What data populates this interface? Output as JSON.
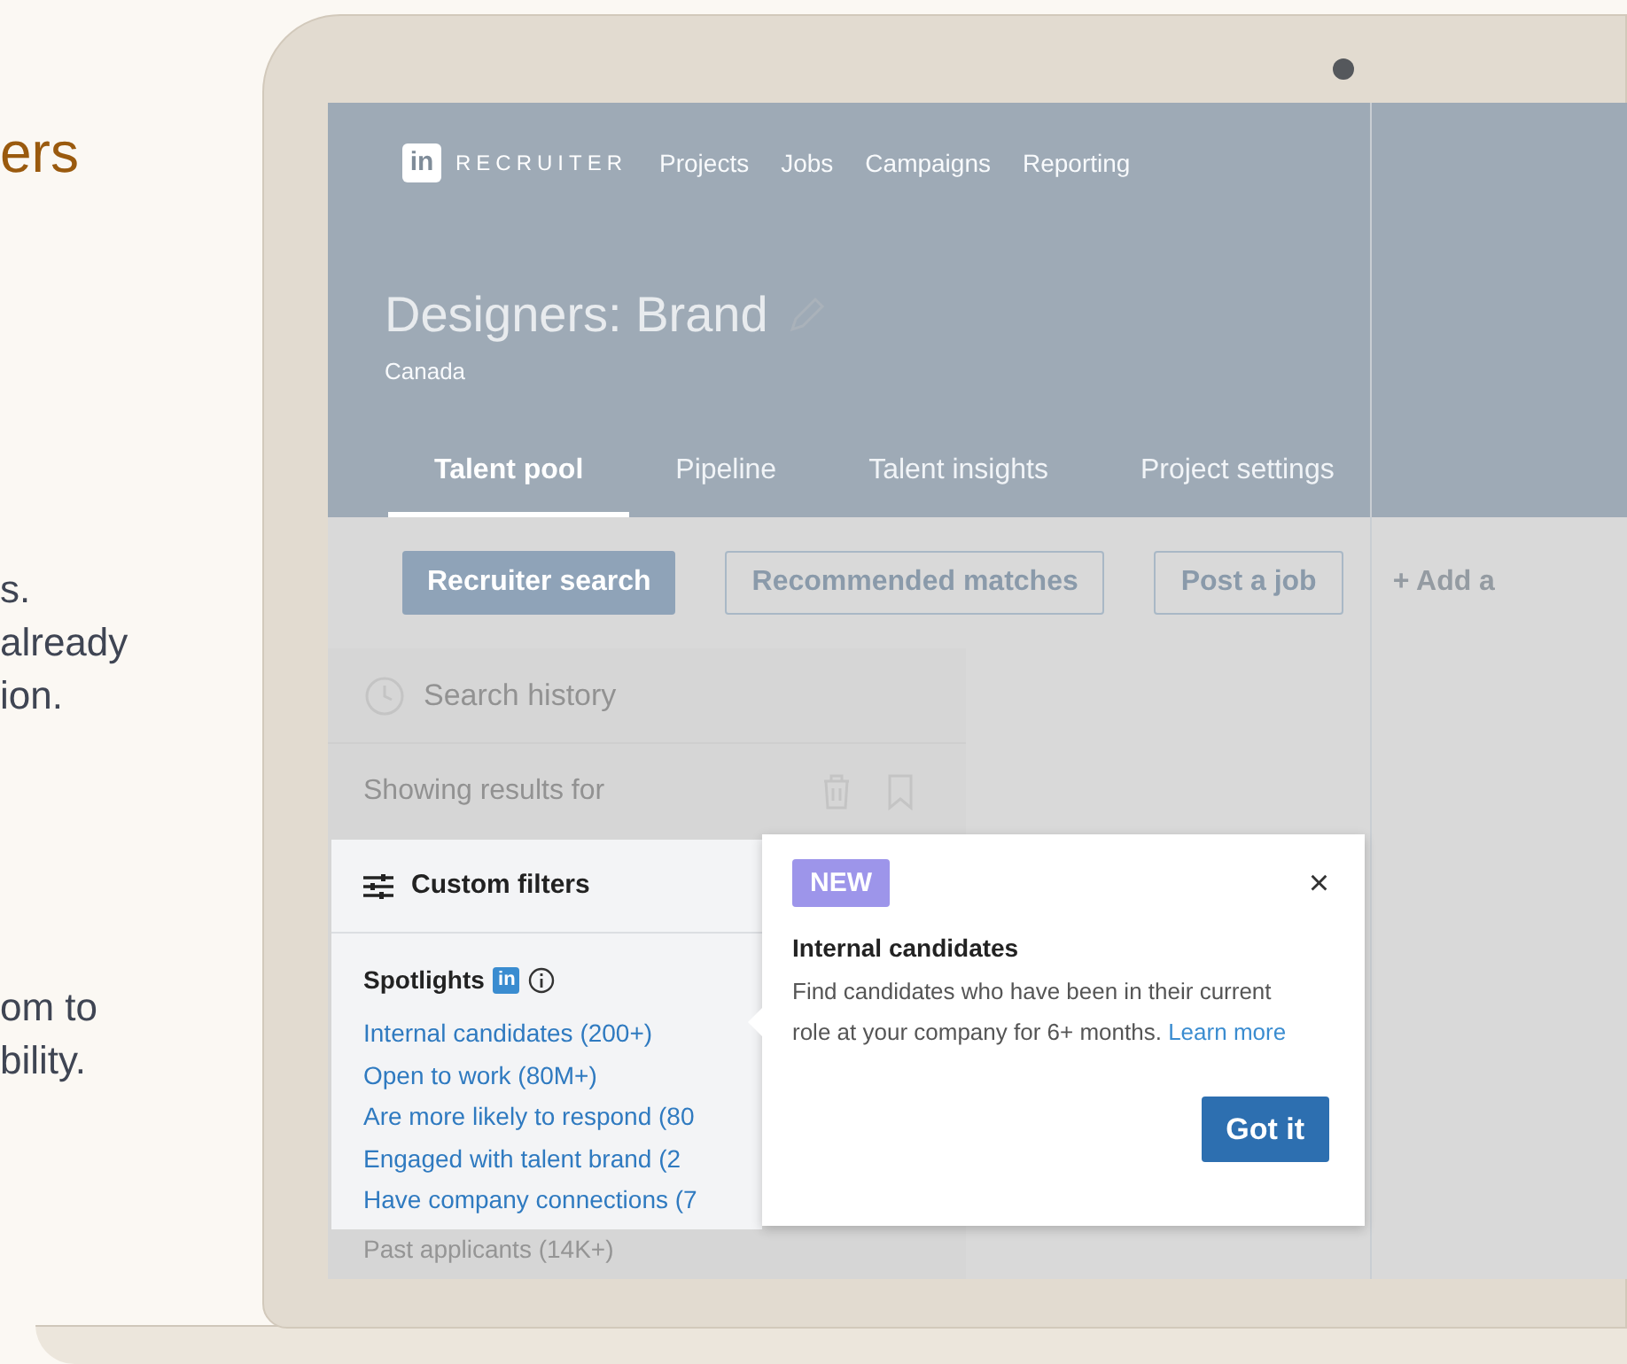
{
  "slide_text": {
    "heading": "ers",
    "lines_top": [
      "s.",
      "already",
      "ion."
    ],
    "lines_bottom": [
      "om to",
      "bility."
    ]
  },
  "nav": {
    "brand": "RECRUITER",
    "logo": "in",
    "items": [
      "Projects",
      "Jobs",
      "Campaigns",
      "Reporting"
    ]
  },
  "project": {
    "title": "Designers: Brand",
    "location": "Canada"
  },
  "tabs": [
    {
      "label": "Talent pool",
      "selected": true
    },
    {
      "label": "Pipeline",
      "selected": false
    },
    {
      "label": "Talent insights",
      "selected": false
    },
    {
      "label": "Project settings",
      "selected": false
    }
  ],
  "actions": [
    {
      "label": "Recruiter search",
      "kind": "primary"
    },
    {
      "label": "Recommended matches",
      "kind": "outline"
    },
    {
      "label": "Post a job",
      "kind": "outline"
    },
    {
      "label": "Add a",
      "kind": "add",
      "icon": "+"
    }
  ],
  "sidebar": {
    "search_history": "Search history",
    "showing_results": "Showing results for",
    "custom_filters": "Custom filters",
    "spotlights": {
      "title": "Spotlights",
      "badge": "in",
      "items": [
        "Internal candidates (200+)",
        "Open to work (80M+)",
        "Are more likely to respond (80",
        "Engaged with talent brand (2",
        "Have company connections (7"
      ]
    },
    "past_applicants": "Past applicants (14K+)"
  },
  "popover": {
    "badge": "NEW",
    "close": "×",
    "title": "Internal candidates",
    "body": "Find candidates who have been in their current role at your company for 6+ months.",
    "link": "Learn more",
    "button": "Got it"
  }
}
